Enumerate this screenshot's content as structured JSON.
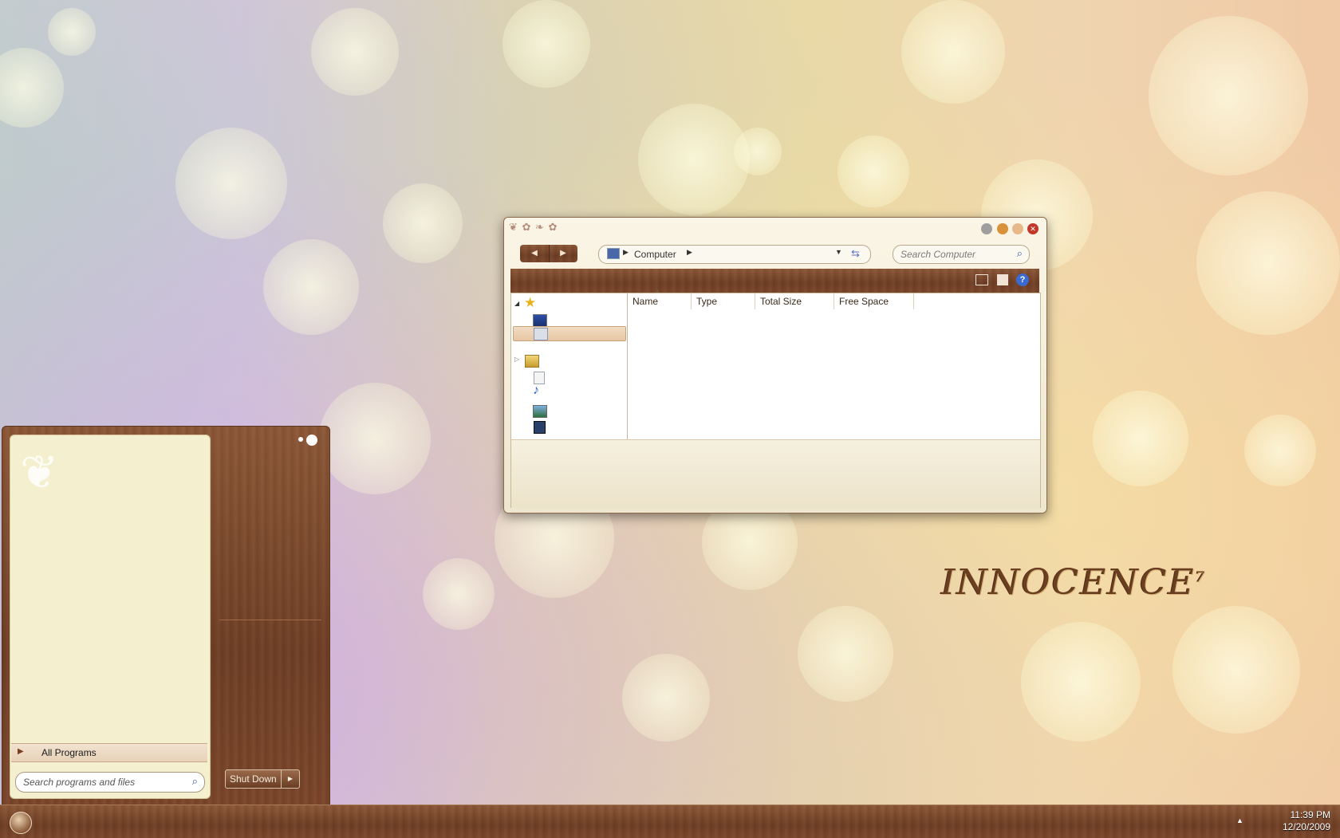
{
  "explorer": {
    "address": "Computer",
    "search_placeholder": "Search Computer",
    "columns": [
      "Name",
      "Type",
      "Total Size",
      "Free Space"
    ]
  },
  "start_menu": {
    "all_programs": "All Programs",
    "search_placeholder": "Search programs and files",
    "shutdown": "Shut Down"
  },
  "wallpaper": {
    "logo_text": "INNOCENCE",
    "logo_superscript": "7"
  },
  "taskbar": {
    "time": "11:39 PM",
    "date": "12/20/2009"
  },
  "colors": {
    "wood": "#7a4529",
    "cream": "#f3efcf",
    "accent": "#c1382b"
  },
  "icons": [
    "favorites-star-icon",
    "desktop-icon",
    "computer-icon",
    "libraries-icon",
    "documents-icon",
    "music-icon",
    "pictures-icon",
    "videos-icon",
    "help-icon",
    "search-icon",
    "refresh-icon"
  ]
}
